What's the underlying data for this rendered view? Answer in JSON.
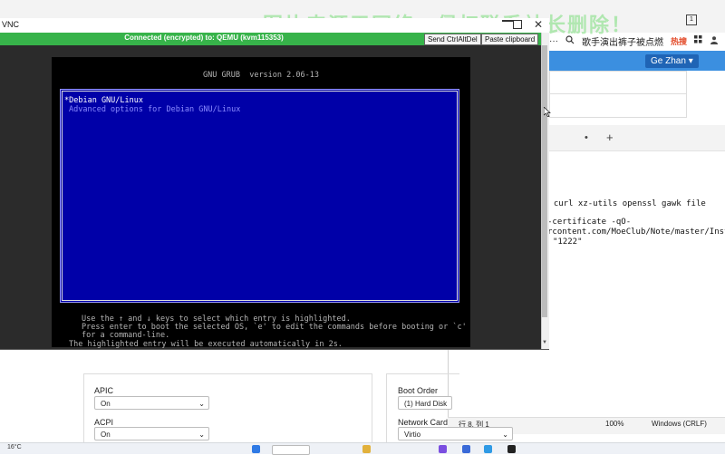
{
  "browser": {
    "watermark": "图片来源于网络，侵权联系站长删除！",
    "sidebar_icon": "1",
    "more_label": "···",
    "news_text": "歌手演出裤子被点燃",
    "hot_label": "热搜",
    "user_menu_label": "Ge Zhan ▾"
  },
  "vnc": {
    "title": "VNC",
    "status": "Connected (encrypted) to: QEMU (kvm115353)",
    "ctrlaltdel_label": "Send CtrlAltDel",
    "paste_label": "Paste clipboard"
  },
  "grub": {
    "header": "GNU GRUB  version 2.06-13",
    "entries": [
      "*Debian GNU/Linux",
      "Advanced options for Debian GNU/Linux"
    ],
    "help": [
      "Use the ↑ and ↓ keys to select which entry is highlighted.",
      "Press enter to boot the selected OS, `e' to edit the commands before booting or `c'",
      "for a command-line.",
      "The highlighted entry will be executed automatically in 2s."
    ],
    "colors": {
      "background": "#0000a8",
      "text": "#ffffff",
      "muted": "#8a8aff"
    }
  },
  "editor": {
    "tab_dot": "•",
    "tab_plus": "+",
    "lines": [
      "t curl xz-utils openssl gawk file",
      "-certificate -qO-",
      "rcontent.com/MoeClub/Note/master/InstallNE",
      "\"1222\""
    ],
    "status": {
      "position": "行 8, 列 1",
      "zoom": "100%",
      "eol": "Windows (CRLF)"
    }
  },
  "form": {
    "apic": {
      "label": "APIC",
      "value": "On"
    },
    "acpi": {
      "label": "ACPI",
      "value": "On"
    },
    "boot_order": {
      "label": "Boot Order",
      "value": "(1) Hard Disk"
    },
    "network_card": {
      "label": "Network Card",
      "value": "Virtio"
    }
  },
  "taskbar": {
    "temperature": "16°C"
  }
}
